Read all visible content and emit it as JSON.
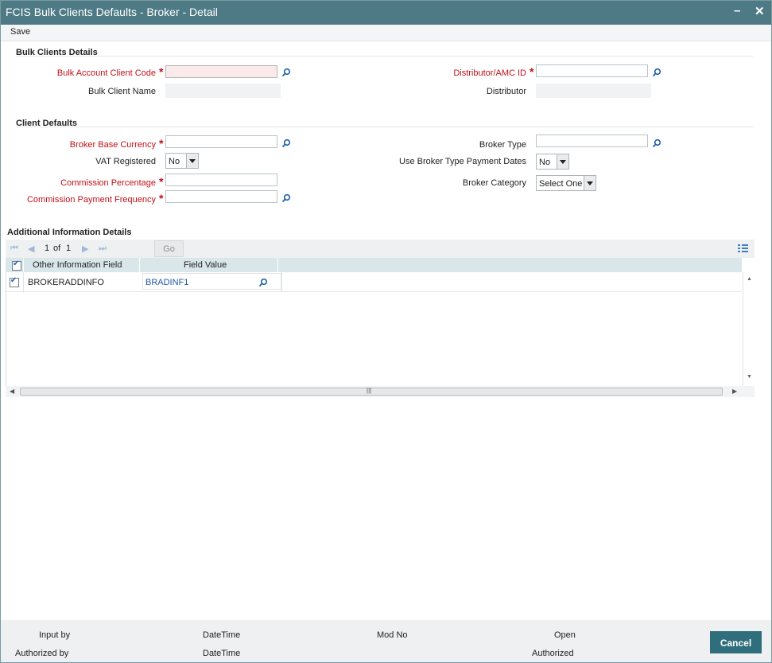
{
  "window": {
    "title": "FCIS Bulk Clients Defaults - Broker - Detail",
    "minimize": "–",
    "close": "✕"
  },
  "toolbar": {
    "save_label": "Save"
  },
  "bulk": {
    "section_title": "Bulk Clients Details",
    "account_code_label": "Bulk Account Client Code",
    "account_code_value": "",
    "client_name_label": "Bulk Client Name",
    "client_name_value": "",
    "distributor_id_label": "Distributor/AMC ID",
    "distributor_id_value": "",
    "distributor_label": "Distributor",
    "distributor_value": ""
  },
  "defaults": {
    "section_title": "Client Defaults",
    "base_currency_label": "Broker Base Currency",
    "vat_label": "VAT Registered",
    "vat_value": "No",
    "commission_pct_label": "Commission Percentage",
    "commission_freq_label": "Commission Payment Frequency",
    "broker_type_label": "Broker Type",
    "use_broker_dates_label": "Use Broker Type Payment Dates",
    "use_broker_dates_value": "No",
    "broker_category_label": "Broker Category",
    "broker_category_value": "Select One"
  },
  "additional": {
    "section_title": "Additional Information Details",
    "pager": {
      "current": "1",
      "of_label": "of",
      "total": "1",
      "go_label": "Go"
    },
    "columns": [
      "Other Information Field",
      "Field Value"
    ],
    "rows": [
      {
        "field": "BROKERADDINFO",
        "value": "BRADINF1",
        "checked": true
      }
    ]
  },
  "footer": {
    "input_by": "Input by",
    "date_time_1": "DateTime",
    "mod_no": "Mod No",
    "open": "Open",
    "authorized_by": "Authorized by",
    "date_time_2": "DateTime",
    "authorized": "Authorized",
    "cancel_label": "Cancel"
  },
  "colors": {
    "titlebar": "#4d7a85",
    "required": "#c0101a",
    "accent_button": "#2f6f7b",
    "search_icon": "#1d5fa8"
  }
}
